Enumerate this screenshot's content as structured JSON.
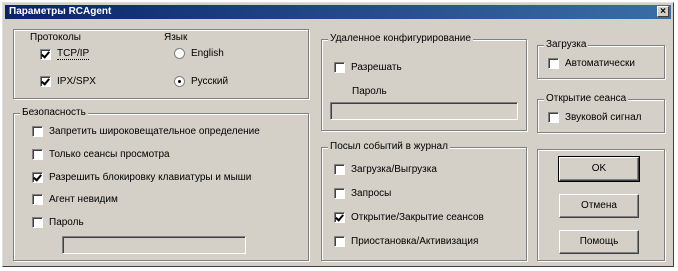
{
  "window": {
    "title": "Параметры RCAgent",
    "close_glyph": "×"
  },
  "protocols": {
    "label": "Протоколы",
    "items": [
      {
        "label": "TCP/IP",
        "checked": true
      },
      {
        "label": "IPX/SPX",
        "checked": true
      }
    ]
  },
  "language": {
    "label": "Язык",
    "items": [
      {
        "label": "English",
        "selected": false
      },
      {
        "label": "Русский",
        "selected": true
      }
    ]
  },
  "security": {
    "label": "Безопасность",
    "items": [
      {
        "label": "Запретить широковещательное определение",
        "checked": false
      },
      {
        "label": "Только сеансы просмотра",
        "checked": false
      },
      {
        "label": "Разрешить блокировку клавиатуры и мыши",
        "checked": true
      },
      {
        "label": "Агент невидим",
        "checked": false
      },
      {
        "label": "Пароль",
        "checked": false
      }
    ],
    "password_value": ""
  },
  "remote_config": {
    "label": "Удаленное конфигурирование",
    "allow_label": "Разрешать",
    "allow_checked": false,
    "password_label": "Пароль",
    "password_value": ""
  },
  "log": {
    "label": "Посыл событий в журнал",
    "items": [
      {
        "label": "Загрузка/Выгрузка",
        "checked": false
      },
      {
        "label": "Запросы",
        "checked": false
      },
      {
        "label": "Открытие/Закрытие сеансов",
        "checked": true
      },
      {
        "label": "Приостановка/Активизация",
        "checked": false
      }
    ]
  },
  "startup": {
    "label": "Загрузка",
    "item": {
      "label": "Автоматически",
      "checked": false
    }
  },
  "session_open": {
    "label": "Открытие сеанса",
    "item": {
      "label": "Звуковой сигнал",
      "checked": false
    }
  },
  "buttons": {
    "ok": "OK",
    "cancel": "Отмена",
    "help": "Помощь"
  }
}
